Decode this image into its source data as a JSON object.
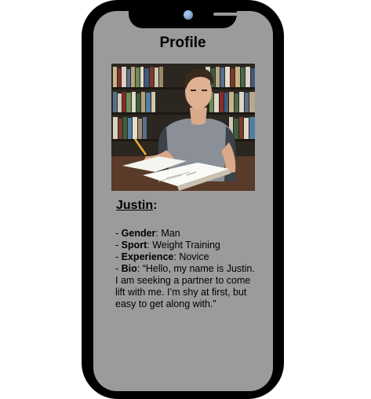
{
  "screen": {
    "title": "Profile"
  },
  "profile": {
    "name": "Justin",
    "name_suffix": ":",
    "fields": [
      {
        "prefix": "- ",
        "label": "Gender",
        "sep": ": ",
        "value": "Man"
      },
      {
        "prefix": "- ",
        "label": "Sport",
        "sep": ": ",
        "value": "Weight Training"
      },
      {
        "prefix": "- ",
        "label": "Experience",
        "sep": ": ",
        "value": "Novice"
      },
      {
        "prefix": "- ",
        "label": "Bio",
        "sep": ": ",
        "value": "“Hello, my name is Justin. I am seeking a partner to come lift with me. I’m shy at first, but easy to get along with.”"
      }
    ]
  },
  "colors": {
    "phone_frame": "#000000",
    "screen": "#9b9b9b",
    "camera": "#9ec2ee"
  },
  "icons": {
    "camera": "front-camera-icon",
    "speaker": "speaker-grille-icon"
  }
}
